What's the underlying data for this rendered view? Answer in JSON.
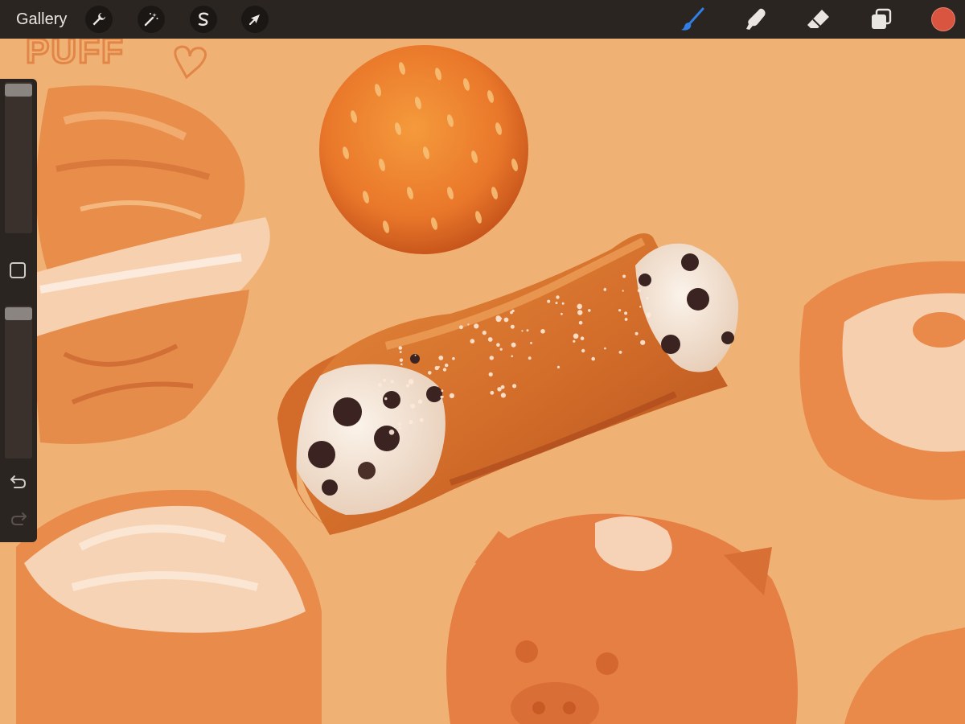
{
  "topbar": {
    "gallery_label": "Gallery",
    "left_tools": [
      {
        "name": "actions",
        "icon": "wrench-icon"
      },
      {
        "name": "adjustments",
        "icon": "magic-wand-icon"
      },
      {
        "name": "selection",
        "icon": "selection-s-icon"
      },
      {
        "name": "transform",
        "icon": "arrow-cursor-icon"
      }
    ],
    "right_tools": [
      {
        "name": "brush",
        "icon": "brush-icon",
        "active": true
      },
      {
        "name": "smudge",
        "icon": "smudge-finger-icon",
        "active": false
      },
      {
        "name": "eraser",
        "icon": "eraser-icon",
        "active": false
      },
      {
        "name": "layers",
        "icon": "layers-icon",
        "active": false
      }
    ],
    "current_color": "#d9553f"
  },
  "sidebar": {
    "brush_size_level": 0.0,
    "opacity_level": 0.0,
    "icons": [
      "modify-square-icon",
      "undo-icon",
      "redo-icon"
    ]
  },
  "canvas": {
    "background_color": "#f0b274",
    "sketch_text": "PUFF"
  },
  "colors": {
    "toolbar_bg": "#2b2521",
    "active_tool": "#2f7fe6",
    "icon_light": "#e9e6e2"
  }
}
